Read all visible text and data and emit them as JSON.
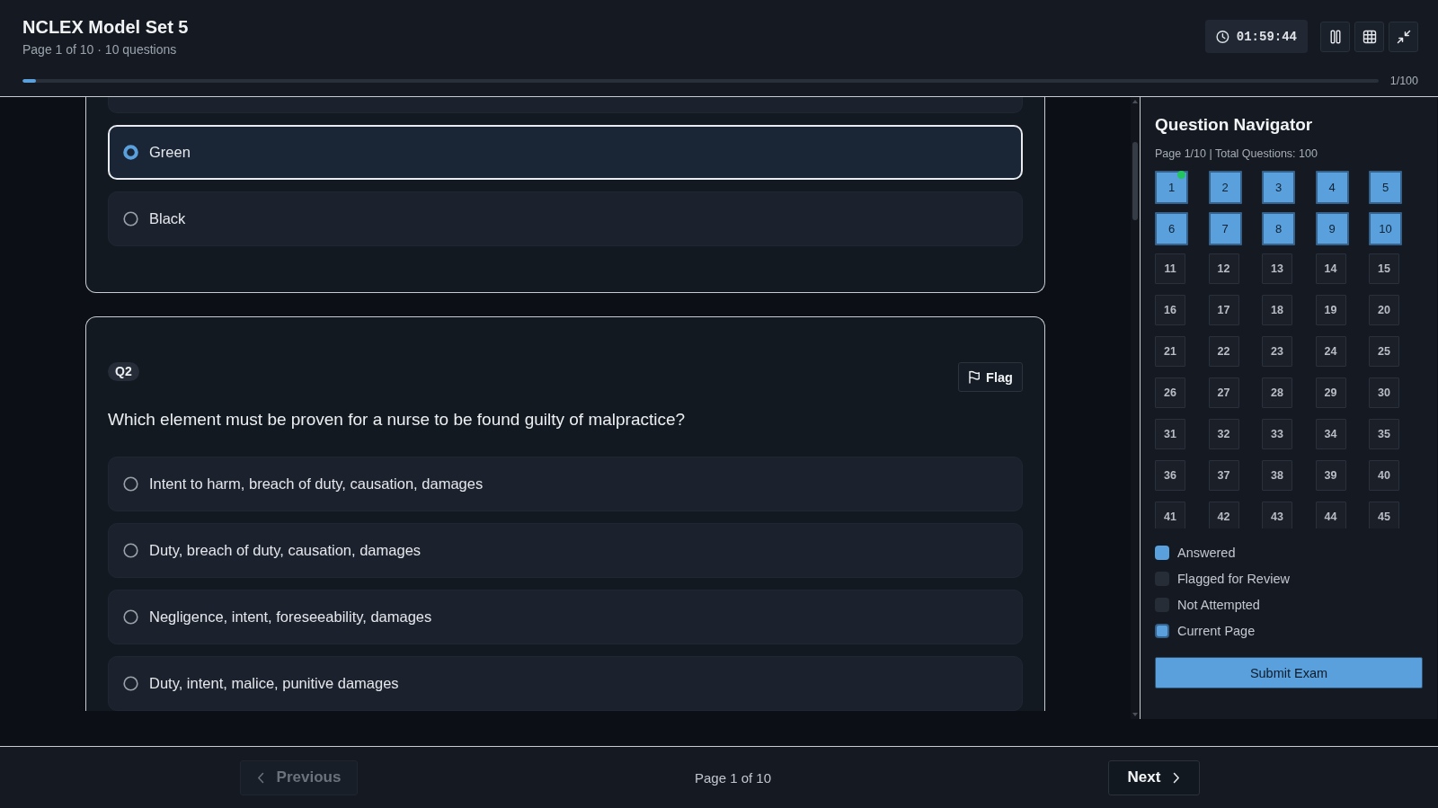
{
  "header": {
    "title": "NCLEX Model Set 5",
    "subtitle": "Page 1 of 10 · 10 questions",
    "timer": "01:59:44",
    "tools": [
      {
        "kind": "pause"
      },
      {
        "kind": "grid"
      },
      {
        "kind": "collapse"
      }
    ],
    "progress": {
      "level": 0.01,
      "label": "1/100"
    }
  },
  "questions": [
    {
      "options": [
        {
          "selected": false
        },
        {
          "label": "Green",
          "selected": true
        },
        {
          "label": "Black",
          "selected": false
        }
      ]
    },
    {
      "number": "Q2",
      "flag": "Flag",
      "text": "Which element must be proven for a nurse to be found guilty of malpractice?",
      "options": [
        {
          "label": "Intent to harm, breach of duty, causation, damages",
          "selected": false
        },
        {
          "label": "Duty, breach of duty, causation, damages",
          "selected": false
        },
        {
          "label": "Negligence, intent, foreseeability, damages",
          "selected": false
        },
        {
          "label": "Duty, intent, malice, punitive damages",
          "selected": false
        }
      ]
    }
  ],
  "navigator": {
    "title": "Question Navigator",
    "summary": "Page 1/10 | Total Questions: 100",
    "cells": [
      {
        "label": "1",
        "current_page": true,
        "answered": true
      },
      {
        "label": "2",
        "current_page": true,
        "answered": false
      },
      {
        "label": "3",
        "current_page": true,
        "answered": false
      },
      {
        "label": "4",
        "current_page": true,
        "answered": false
      },
      {
        "label": "5",
        "current_page": true,
        "answered": false
      },
      {
        "label": "6",
        "current_page": true,
        "answered": false
      },
      {
        "label": "7",
        "current_page": true,
        "answered": false
      },
      {
        "label": "8",
        "current_page": true,
        "answered": false
      },
      {
        "label": "9",
        "current_page": true,
        "answered": false
      },
      {
        "label": "10",
        "current_page": true,
        "answered": false
      },
      {
        "label": "11",
        "current_page": false,
        "answered": false
      },
      {
        "label": "12",
        "current_page": false,
        "answered": false
      },
      {
        "label": "13",
        "current_page": false,
        "answered": false
      },
      {
        "label": "14",
        "current_page": false,
        "answered": false
      },
      {
        "label": "15",
        "current_page": false,
        "answered": false
      },
      {
        "label": "16",
        "current_page": false,
        "answered": false
      },
      {
        "label": "17",
        "current_page": false,
        "answered": false
      },
      {
        "label": "18",
        "current_page": false,
        "answered": false
      },
      {
        "label": "19",
        "current_page": false,
        "answered": false
      },
      {
        "label": "20",
        "current_page": false,
        "answered": false
      },
      {
        "label": "21",
        "current_page": false,
        "answered": false
      },
      {
        "label": "22",
        "current_page": false,
        "answered": false
      },
      {
        "label": "23",
        "current_page": false,
        "answered": false
      },
      {
        "label": "24",
        "current_page": false,
        "answered": false
      },
      {
        "label": "25",
        "current_page": false,
        "answered": false
      },
      {
        "label": "26",
        "current_page": false,
        "answered": false
      },
      {
        "label": "27",
        "current_page": false,
        "answered": false
      },
      {
        "label": "28",
        "current_page": false,
        "answered": false
      },
      {
        "label": "29",
        "current_page": false,
        "answered": false
      },
      {
        "label": "30",
        "current_page": false,
        "answered": false
      },
      {
        "label": "31",
        "current_page": false,
        "answered": false
      },
      {
        "label": "32",
        "current_page": false,
        "answered": false
      },
      {
        "label": "33",
        "current_page": false,
        "answered": false
      },
      {
        "label": "34",
        "current_page": false,
        "answered": false
      },
      {
        "label": "35",
        "current_page": false,
        "answered": false
      },
      {
        "label": "36",
        "current_page": false,
        "answered": false
      },
      {
        "label": "37",
        "current_page": false,
        "answered": false
      },
      {
        "label": "38",
        "current_page": false,
        "answered": false
      },
      {
        "label": "39",
        "current_page": false,
        "answered": false
      },
      {
        "label": "40",
        "current_page": false,
        "answered": false
      },
      {
        "label": "41",
        "current_page": false,
        "answered": false
      },
      {
        "label": "42",
        "current_page": false,
        "answered": false
      },
      {
        "label": "43",
        "current_page": false,
        "answered": false
      },
      {
        "label": "44",
        "current_page": false,
        "answered": false
      },
      {
        "label": "45",
        "current_page": false,
        "answered": false
      }
    ],
    "legend": [
      {
        "label": "Answered",
        "color": "#5aa0dc",
        "outlined": false
      },
      {
        "label": "Flagged for Review",
        "color": "#272d37",
        "outlined": false
      },
      {
        "label": "Not Attempted",
        "color": "#272d37",
        "outlined": false
      },
      {
        "label": "Current Page",
        "color": "#5aa0dc",
        "outlined": true
      }
    ],
    "submit": "Submit Exam"
  },
  "footer": {
    "previous": {
      "label": "Previous",
      "disabled": true
    },
    "page": "Page 1 of 10",
    "next": {
      "label": "Next",
      "disabled": false
    }
  }
}
